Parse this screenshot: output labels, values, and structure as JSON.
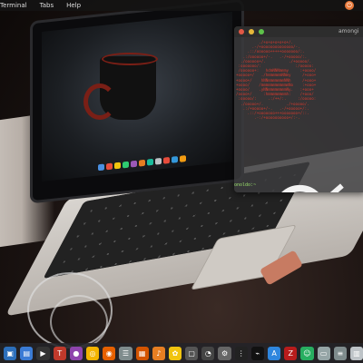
{
  "menubar": {
    "items": [
      "Terminal",
      "Tabs",
      "Help"
    ],
    "tray_icon": "ubuntu-icon"
  },
  "terminal": {
    "title": "amongi",
    "prompt": "onoldo:~",
    "ascii_lines": [
      "          ./+o+o+o+o+o+/.",
      "       .-/+oooooooooooooo/-.",
      "     .::/oooooo+++++ooooooo/:.",
      "   .:/oooooo+/-.   .-/+ooooo/:.",
      "  ./oooooo+/.          ./+ooooo/.",
      " :ooooooo/:               :/ooooo:",
      " /oooooo+:   hdmNNNmmmy     :+oooo/",
      "+ooooo+/   ./hmmmmmmNNmy     /+ooo+",
      "+oooo+/    hNNmmmmmmmNNh     /+ooo+",
      "+oooo/    /mmmmmmmmmmmmNo    :+ooo+",
      "+oooo/    .yNNmmmmmmmmNy.   :+ooo+",
      "/oooo+/     :hmmmmmmmmh:    /+ooo/",
      " :ooooo/:     .:/++/:.     :/ooooo:",
      "  ./ooooo+/.          ./+ooooo/.",
      "   .:/+ooooo+/-.   .-/+ooooo+/:.",
      "     .::/+ooooooo+++ooooooo+/::.",
      "        .-:/+oooooooooo+/:-."
    ]
  },
  "dock": {
    "icons": [
      "files-icon",
      "folder-icon",
      "terminal-icon",
      "gedit-icon",
      "tweak-icon",
      "chrome-icon",
      "firefox-icon",
      "settings-icon",
      "calendar-icon",
      "music-icon",
      "photos-icon",
      "shell-icon",
      "clock-icon",
      "gear-icon",
      "apps-icon",
      "activity-icon",
      "appstore-icon",
      "filezilla-icon",
      "android-icon",
      "display-icon",
      "notes-icon",
      "trash-icon"
    ]
  },
  "colors": {
    "accent_orange": "#e8793a",
    "term_red": "#d23a2e",
    "prompt_green": "#9be36b"
  }
}
